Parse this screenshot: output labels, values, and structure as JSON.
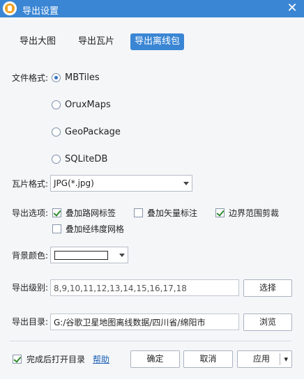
{
  "window": {
    "title": "导出设置",
    "close_icon": "close-icon"
  },
  "tabs": [
    {
      "label": "导出大图",
      "active": false
    },
    {
      "label": "导出瓦片",
      "active": false
    },
    {
      "label": "导出离线包",
      "active": true
    }
  ],
  "file_format": {
    "label": "文件格式:",
    "options": [
      {
        "label": "MBTiles",
        "checked": true
      },
      {
        "label": "OruxMaps",
        "checked": false
      },
      {
        "label": "GeoPackage",
        "checked": false
      },
      {
        "label": "SQLiteDB",
        "checked": false
      }
    ]
  },
  "tile_format": {
    "label": "瓦片格式:",
    "value": "JPG(*.jpg)"
  },
  "export_options": {
    "label": "导出选项:",
    "items": [
      {
        "label": "叠加路网标签",
        "checked": true
      },
      {
        "label": "叠加矢量标注",
        "checked": false
      },
      {
        "label": "边界范围剪裁",
        "checked": true
      },
      {
        "label": "叠加经纬度网格",
        "checked": false
      }
    ]
  },
  "background_color": {
    "label": "背景颜色:",
    "value": "#ffffff"
  },
  "export_levels": {
    "label": "导出级别:",
    "value": "8,9,10,11,12,13,14,15,16,17,18",
    "button": "选择"
  },
  "export_dir": {
    "label": "导出目录:",
    "value": "G:/谷歌卫星地图离线数据/四川省/绵阳市",
    "button": "浏览"
  },
  "footer": {
    "open_after": {
      "label": "完成后打开目录",
      "checked": true
    },
    "help_link": "帮助",
    "ok": "确定",
    "cancel": "取消",
    "apply": "应用"
  },
  "colors": {
    "accent": "#3a86d4"
  }
}
